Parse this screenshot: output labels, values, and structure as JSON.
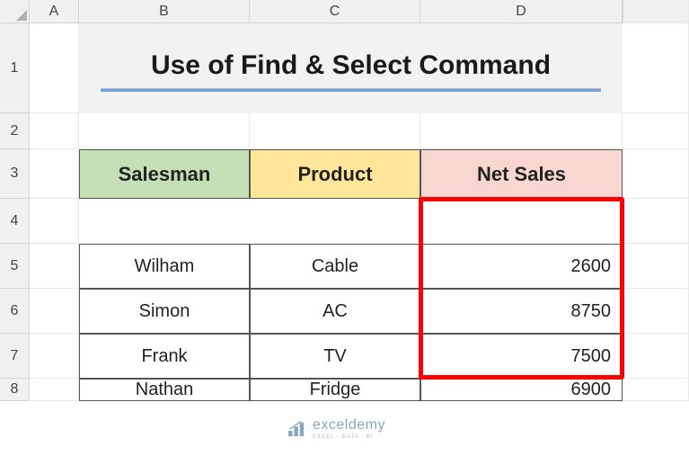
{
  "columns": [
    "A",
    "B",
    "C",
    "D"
  ],
  "rows": [
    "1",
    "2",
    "3",
    "4",
    "5",
    "6",
    "7",
    "8"
  ],
  "title": "Use of Find & Select Command",
  "headers": {
    "salesman": "Salesman",
    "product": "Product",
    "netsales": "Net Sales"
  },
  "data": [
    {
      "salesman": "Wilham",
      "product": "Cable",
      "netsales": "2600"
    },
    {
      "salesman": "Simon",
      "product": "AC",
      "netsales": "8750"
    },
    {
      "salesman": "Frank",
      "product": "TV",
      "netsales": "7500"
    },
    {
      "salesman": "Nathan",
      "product": "Fridge",
      "netsales": "6900"
    }
  ],
  "logo": {
    "name": "exceldemy",
    "tag": "EXCEL · DATA · BI"
  },
  "chart_data": {
    "type": "table",
    "title": "Use of Find & Select Command",
    "columns": [
      "Salesman",
      "Product",
      "Net Sales"
    ],
    "rows": [
      [
        "Wilham",
        "Cable",
        2600
      ],
      [
        "Simon",
        "AC",
        8750
      ],
      [
        "Frank",
        "TV",
        7500
      ],
      [
        "Nathan",
        "Fridge",
        6900
      ]
    ],
    "highlighted_column": "Net Sales"
  }
}
